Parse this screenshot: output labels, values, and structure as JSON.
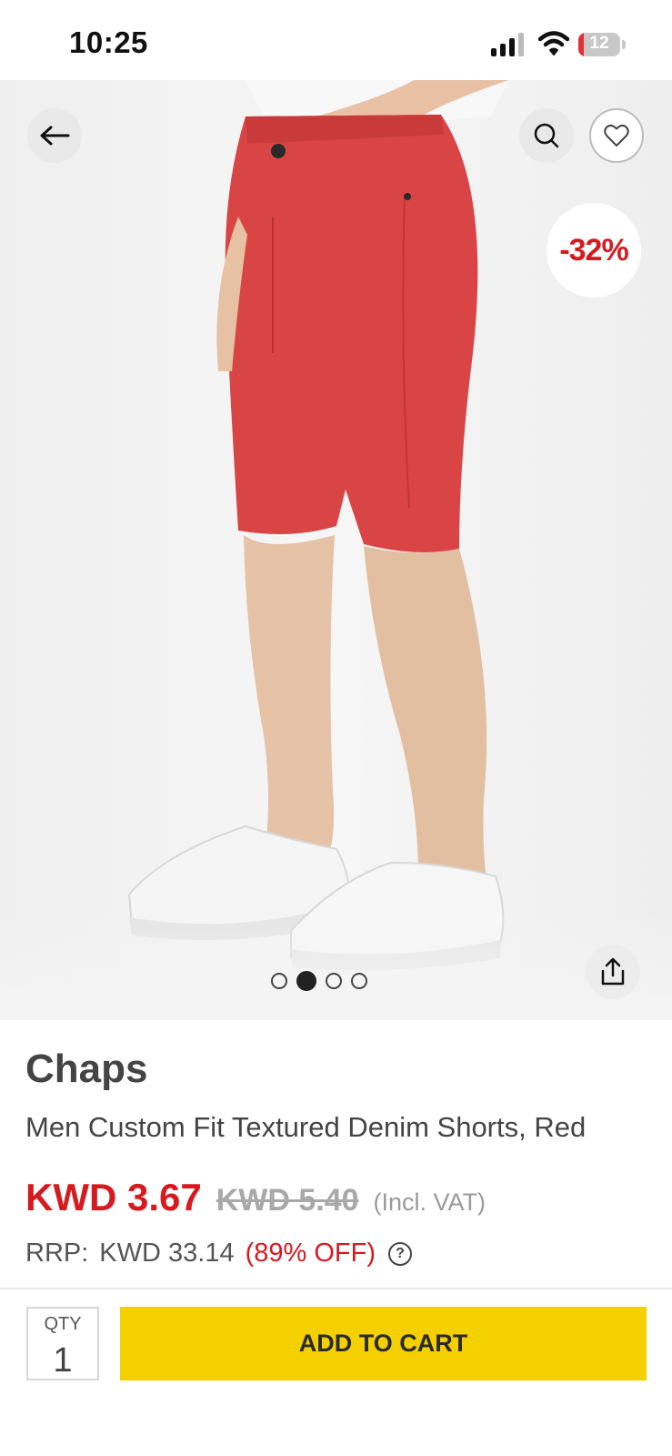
{
  "status_bar": {
    "time": "10:25",
    "battery_level": "12",
    "battery_fraction": 0.12,
    "icons": [
      "cellular-signal-icon",
      "wifi-icon",
      "battery-icon"
    ]
  },
  "gallery": {
    "discount_badge": "-32%",
    "image_count": 4,
    "active_index": 1,
    "icons": [
      "back-arrow-icon",
      "search-icon",
      "heart-icon",
      "share-icon"
    ]
  },
  "product": {
    "brand": "Chaps",
    "name": "Men Custom Fit Textured Denim Shorts, Red",
    "price_now": "KWD 3.67",
    "price_was": "KWD 5.40",
    "vat_note": "(Incl. VAT)",
    "rrp_label": "RRP:",
    "rrp_value": "KWD 33.14",
    "rrp_off": "(89% OFF)",
    "help_symbol": "?"
  },
  "cart_bar": {
    "qty_label": "QTY",
    "qty_value": "1",
    "add_to_cart_label": "ADD TO CART"
  },
  "colors": {
    "accent_red": "#d71920",
    "cart_yellow": "#f5d000",
    "text_dark": "#444444"
  }
}
